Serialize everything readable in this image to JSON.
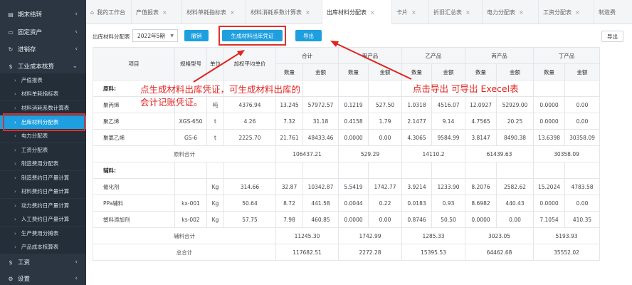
{
  "sidebar": {
    "top_items": [
      {
        "label": "期末结转",
        "icon": "clipboard-icon"
      },
      {
        "label": "固定资产",
        "icon": "monitor-icon"
      },
      {
        "label": "进销存",
        "icon": "refresh-icon"
      },
      {
        "label": "工业成本核算",
        "icon": "dollar-icon"
      }
    ],
    "sub_items": [
      "产值报表",
      "材料单耗指标表",
      "材料消耗系数计算表",
      "出库材料分配表",
      "电力分配表",
      "工资分配表",
      "制造费用分配表",
      "制造费约日产量计算",
      "材料费约日产量计算",
      "动力费约日产量计算",
      "人工费约日产量计算",
      "生产费用分摊表",
      "产品成本核算表"
    ],
    "bottom_items": [
      {
        "label": "工资",
        "icon": "dollar-icon"
      },
      {
        "label": "设置",
        "icon": "gear-icon"
      }
    ]
  },
  "tabs": [
    "我的工作台",
    "产值报表",
    "材料单耗指标表",
    "材料消耗系数计算表",
    "出库材料分配表",
    "卡片",
    "折旧汇总表",
    "电力分配表",
    "工资分配表",
    "制造费"
  ],
  "toolbar": {
    "label": "出库材料分配表",
    "period": "2022年5期",
    "cancel": "撤销",
    "generate": "生成材料出库凭证",
    "export": "导出",
    "export_right": "导出"
  },
  "table": {
    "headers": {
      "item": "项目",
      "spec": "规格型号",
      "unit": "单位",
      "avg_price": "加权平均单价",
      "total": "合计",
      "prod_a": "甲产品",
      "prod_b": "乙产品",
      "prod_c": "丙产品",
      "prod_d": "丁产品",
      "qty": "数量",
      "amt": "金额"
    },
    "section_raw": "原料:",
    "raw_rows": [
      [
        "聚丙烯",
        "",
        "吨",
        "4376.94",
        "13.245",
        "57972.57",
        "0.1219",
        "527.50",
        "1.0318",
        "4516.07",
        "12.0927",
        "52929.00",
        "0.0000",
        "0.00"
      ],
      [
        "聚乙烯",
        "XGS-650",
        "t",
        "4.26",
        "7.32",
        "31.18",
        "0.4158",
        "1.79",
        "2.1477",
        "9.14",
        "4.7565",
        "20.25",
        "0.0000",
        "0.00"
      ],
      [
        "聚氯乙烯",
        "GS-6",
        "t",
        "2225.70",
        "21.761",
        "48433.46",
        "0.0000",
        "0.00",
        "4.3065",
        "9584.99",
        "3.8147",
        "8490.38",
        "13.6398",
        "30358.09"
      ]
    ],
    "raw_total": [
      "原料合计",
      "106437.21",
      "529.29",
      "14110.2",
      "61439.63",
      "30358.09"
    ],
    "section_aux": "辅料:",
    "aux_rows": [
      [
        "催化剂",
        "",
        "Kg",
        "314.66",
        "32.87",
        "10342.87",
        "5.5419",
        "1742.77",
        "3.9214",
        "1233.90",
        "8.2076",
        "2582.62",
        "15.2024",
        "4783.58"
      ],
      [
        "PPa辅料",
        "kx-001",
        "Kg",
        "50.64",
        "8.72",
        "441.58",
        "0.0044",
        "0.22",
        "0.0183",
        "0.93",
        "8.6982",
        "440.43",
        "0.0000",
        "0.00"
      ],
      [
        "塑料添加剂",
        "ks-002",
        "Kg",
        "57.75",
        "7.98",
        "460.85",
        "0.0000",
        "0.00",
        "0.8746",
        "50.50",
        "0.0000",
        "0.00",
        "7.1054",
        "410.35"
      ]
    ],
    "aux_total": [
      "辅料合计",
      "11245.30",
      "1742.99",
      "1285.33",
      "3023.05",
      "5193.93"
    ],
    "grand_total": [
      "总合计",
      "117682.51",
      "2272.28",
      "15395.53",
      "64462.68",
      "35552.02"
    ]
  },
  "annotations": {
    "left_line1": "点生成材料出库凭证，可生成材料出库的",
    "left_line2": "会计记账凭证。",
    "right": "点击导出 可导出 Execel表"
  },
  "colors": {
    "accent": "#1e9fe0",
    "sidebar": "#2b3642",
    "annotation": "#e02420"
  }
}
